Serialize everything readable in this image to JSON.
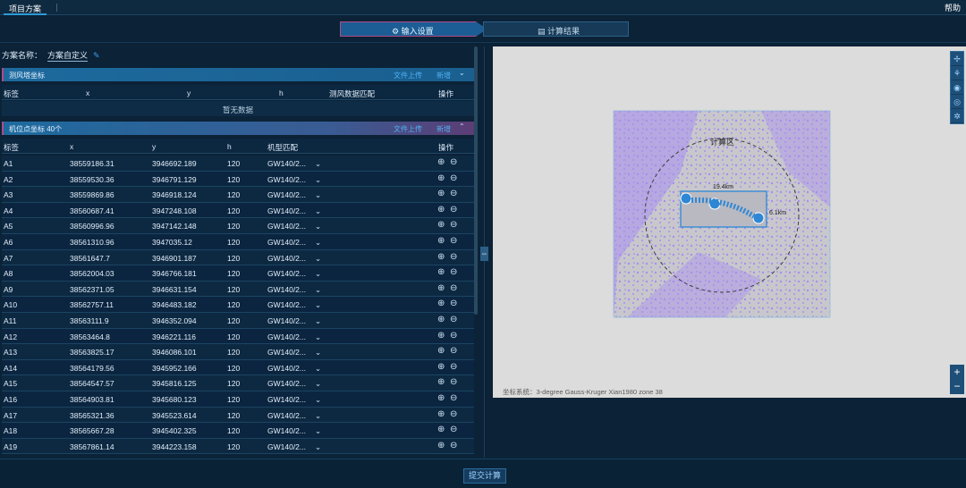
{
  "topbar": {
    "tab": "项目方案",
    "help": "帮助"
  },
  "steps": [
    {
      "label": "输入设置"
    },
    {
      "label": "计算结果"
    }
  ],
  "scheme": {
    "label": "方案名称：",
    "value": "方案自定义"
  },
  "tower_section": {
    "title": "测风塔坐标",
    "upload": "文件上传",
    "add": "新增",
    "columns": [
      "标签",
      "x",
      "y",
      "h",
      "测风数据匹配",
      "操作"
    ],
    "empty": "暂无数据"
  },
  "turbine_section": {
    "title": "机位点坐标 40个",
    "upload": "文件上传",
    "add": "新增",
    "columns": [
      "标签",
      "x",
      "y",
      "h",
      "机型匹配",
      "操作"
    ],
    "rows": [
      {
        "label": "A1",
        "x": "38559186.31",
        "y": "3946692.189",
        "h": "120",
        "model": "GW140/2..."
      },
      {
        "label": "A2",
        "x": "38559530.36",
        "y": "3946791.129",
        "h": "120",
        "model": "GW140/2..."
      },
      {
        "label": "A3",
        "x": "38559869.86",
        "y": "3946918.124",
        "h": "120",
        "model": "GW140/2..."
      },
      {
        "label": "A4",
        "x": "38560687.41",
        "y": "3947248.108",
        "h": "120",
        "model": "GW140/2..."
      },
      {
        "label": "A5",
        "x": "38560996.96",
        "y": "3947142.148",
        "h": "120",
        "model": "GW140/2..."
      },
      {
        "label": "A6",
        "x": "38561310.96",
        "y": "3947035.12",
        "h": "120",
        "model": "GW140/2..."
      },
      {
        "label": "A7",
        "x": "38561647.7",
        "y": "3946901.187",
        "h": "120",
        "model": "GW140/2..."
      },
      {
        "label": "A8",
        "x": "38562004.03",
        "y": "3946766.181",
        "h": "120",
        "model": "GW140/2..."
      },
      {
        "label": "A9",
        "x": "38562371.05",
        "y": "3946631.154",
        "h": "120",
        "model": "GW140/2..."
      },
      {
        "label": "A10",
        "x": "38562757.11",
        "y": "3946483.182",
        "h": "120",
        "model": "GW140/2..."
      },
      {
        "label": "A11",
        "x": "38563111.9",
        "y": "3946352.094",
        "h": "120",
        "model": "GW140/2..."
      },
      {
        "label": "A12",
        "x": "38563464.8",
        "y": "3946221.116",
        "h": "120",
        "model": "GW140/2..."
      },
      {
        "label": "A13",
        "x": "38563825.17",
        "y": "3946086.101",
        "h": "120",
        "model": "GW140/2..."
      },
      {
        "label": "A14",
        "x": "38564179.56",
        "y": "3945952.166",
        "h": "120",
        "model": "GW140/2..."
      },
      {
        "label": "A15",
        "x": "38564547.57",
        "y": "3945816.125",
        "h": "120",
        "model": "GW140/2..."
      },
      {
        "label": "A16",
        "x": "38564903.81",
        "y": "3945680.123",
        "h": "120",
        "model": "GW140/2..."
      },
      {
        "label": "A17",
        "x": "38565321.36",
        "y": "3945523.614",
        "h": "120",
        "model": "GW140/2..."
      },
      {
        "label": "A18",
        "x": "38565667.28",
        "y": "3945402.325",
        "h": "120",
        "model": "GW140/2..."
      },
      {
        "label": "A19",
        "x": "38567861.14",
        "y": "3944223.158",
        "h": "120",
        "model": "GW140/2..."
      }
    ]
  },
  "map": {
    "area_label": "计算区",
    "dim1": "19.4km",
    "dim2": "6.1km",
    "coord_system": "坐标系统：3-degree Gauss-Kruger Xian1980 zone 38"
  },
  "submit": "提交计算"
}
